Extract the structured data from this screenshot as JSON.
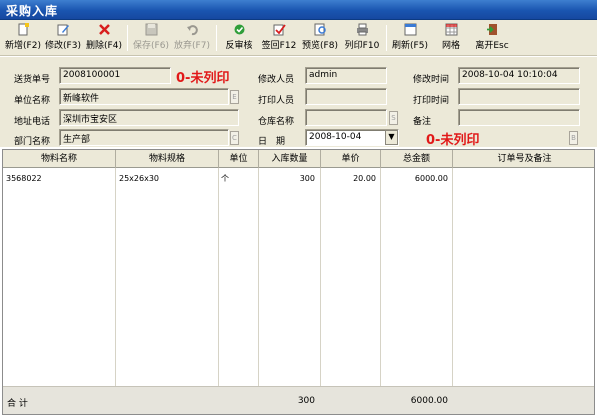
{
  "window": {
    "title": "采购入库"
  },
  "toolbar": [
    {
      "label": "新增(F2)",
      "icon": "new-doc-icon",
      "enabled": true
    },
    {
      "label": "修改(F3)",
      "icon": "edit-icon",
      "enabled": true
    },
    {
      "label": "删除(F4)",
      "icon": "delete-x-icon",
      "enabled": true
    },
    {
      "label": "保存(F6)",
      "icon": "save-icon",
      "enabled": false
    },
    {
      "label": "放弃(F7)",
      "icon": "undo-icon",
      "enabled": false
    },
    {
      "label": "反审核",
      "icon": "unaudit-icon",
      "enabled": true
    },
    {
      "label": "签回F12",
      "icon": "sign-back-icon",
      "enabled": true
    },
    {
      "label": "预览(F8)",
      "icon": "preview-icon",
      "enabled": true
    },
    {
      "label": "列印F10",
      "icon": "print-icon",
      "enabled": true
    },
    {
      "label": "刷新(F5)",
      "icon": "refresh-icon",
      "enabled": true
    },
    {
      "label": "网格",
      "icon": "grid-icon",
      "enabled": true
    },
    {
      "label": "离开Esc",
      "icon": "exit-icon",
      "enabled": true
    }
  ],
  "form": {
    "delivery_no_label": "送货单号",
    "delivery_no": "2008100001",
    "status_left": "0-未列印",
    "company_label": "单位名称",
    "company": "新峰软件",
    "address_label": "地址电话",
    "address": "深圳市宝安区",
    "dept_label": "部门名称",
    "dept": "生产部",
    "modifier_label": "修改人员",
    "modifier": "admin",
    "printer_label": "打印人员",
    "printer": "",
    "warehouse_label": "仓库名称",
    "warehouse": "",
    "date_label": "日　期",
    "date": "2008-10-04",
    "modtime_label": "修改时间",
    "modtime": "2008-10-04 10:10:04",
    "printtime_label": "打印时间",
    "printtime": "",
    "remark_label": "备注",
    "remark": "",
    "status_right": "0-未列印",
    "btn_e": "E",
    "btn_c": "C",
    "btn_s": "S",
    "btn_b": "B"
  },
  "table": {
    "columns": [
      "物料名称",
      "物料规格",
      "单位",
      "入库数量",
      "单价",
      "总金额",
      "订单号及备注"
    ],
    "rows": [
      {
        "name": "3568022",
        "spec": "25x26x30",
        "unit": "个",
        "qty": "300",
        "price": "20.00",
        "amount": "6000.00",
        "remark": ""
      }
    ],
    "footer": {
      "label": "合 计",
      "qty": "300",
      "amount": "6000.00"
    }
  }
}
